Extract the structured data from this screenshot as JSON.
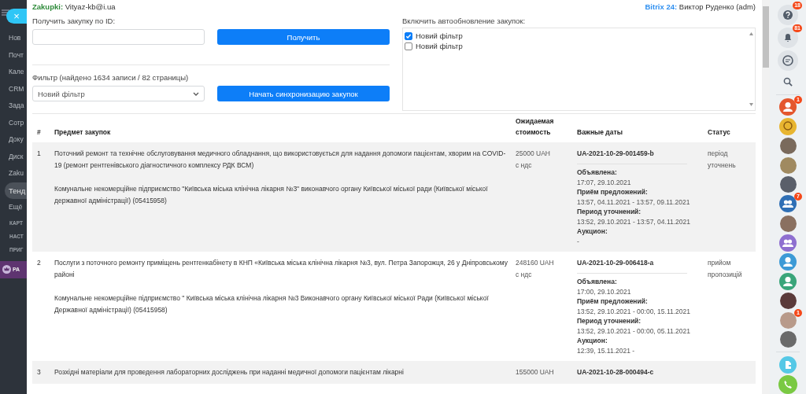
{
  "sidebar": {
    "close_button": "×",
    "items": [
      {
        "label": "Нов",
        "selected": false
      },
      {
        "label": "Почт",
        "selected": false
      },
      {
        "label": "Кале",
        "selected": false
      },
      {
        "label": "CRM",
        "selected": false
      },
      {
        "label": "Зада",
        "selected": false
      },
      {
        "label": "Сотр",
        "selected": false
      },
      {
        "label": "Доку",
        "selected": false
      },
      {
        "label": "Диск",
        "selected": false
      },
      {
        "label": "Zaku",
        "selected": false
      },
      {
        "label": "Тенд",
        "selected": true
      },
      {
        "label": "Ещё",
        "selected": false
      }
    ],
    "small_items": [
      "КАРТ",
      "НАСТ",
      "ПРИГ"
    ],
    "promo": "РА"
  },
  "header": {
    "app_label": "Zakupki:",
    "app_value": "Vityaz-kb@i.ua",
    "system_label": "Bitrix 24:",
    "system_value": "Виктор Руденко (adm)"
  },
  "id_form": {
    "label": "Получить закупку по ID:",
    "button": "Получить"
  },
  "filter": {
    "label": "Фильтр (найдено 1634 записи / 82 страницы)",
    "value": "Новий фільтр",
    "button": "Начать синхронизацию закупок"
  },
  "autoupdate": {
    "label": "Включить автообновление закупок:",
    "filters": [
      {
        "label": "Новий фільтр",
        "checked": true
      },
      {
        "label": "Новий фільтр",
        "checked": false
      }
    ]
  },
  "table": {
    "columns": [
      "#",
      "Предмет закупок",
      "Ожидаемая стоимость",
      "Важные даты",
      "Статус"
    ],
    "rows": [
      {
        "number": "1",
        "subject": "Поточний ремонт та технічне обслуговування медичного обладнання, що використовується для надання допомоги пацієнтам, хворим на COVID-19 (ремонт рентгенівського діагностичного комплексу РДК ВСМ)",
        "customer": "Комунальне некомерційне підприємство \"Київська міська клінічна лікарня №3\" виконавчого органу Київської міської ради (Київської міської державної адміністрації) (05415958)",
        "cost": "25000 UAH",
        "cost_note": "с ндс",
        "tender_id": "UA-2021-10-29-001459-b",
        "dates": [
          {
            "label": "Объявлена:",
            "value": "17:07, 29.10.2021"
          },
          {
            "label": "Приём предложений:",
            "value": "13:57, 04.11.2021 - 13:57, 09.11.2021"
          },
          {
            "label": "Период уточнений:",
            "value": "13:52, 29.10.2021 - 13:57, 04.11.2021"
          },
          {
            "label": "Аукцион:",
            "value": "-"
          }
        ],
        "status": "період уточнень"
      },
      {
        "number": "2",
        "subject": "Послуги з поточного ремонту приміщень рентгенкабінету в КНП «Київська міська клінічна лікарня №3, вул. Петра Запорожця, 26 у Дніпровському районі",
        "customer": "Комунальне некомерційне підприємство \" Київська міська клінічна лікарня №3 Виконавчого органу Київської міської Ради (Київської міської Державної адміністрації) (05415958)",
        "cost": "248160 UAH",
        "cost_note": "с ндс",
        "tender_id": "UA-2021-10-29-006418-a",
        "dates": [
          {
            "label": "Объявлена:",
            "value": "17:00, 29.10.2021"
          },
          {
            "label": "Приём предложений:",
            "value": "13:52, 29.10.2021 - 00:00, 15.11.2021"
          },
          {
            "label": "Период уточнений:",
            "value": "13:52, 29.10.2021 - 00:00, 05.11.2021"
          },
          {
            "label": "Аукцион:",
            "value": "12:39, 15.11.2021 -"
          }
        ],
        "status": "прийом пропозицій"
      },
      {
        "number": "3",
        "subject": "Розхідні матеріали для проведення лабораторних досліджень при наданні медичної допомоги пацієнтам лікарні",
        "cost": "155000 UAH",
        "tender_id": "UA-2021-10-28-000494-c"
      }
    ]
  },
  "right_bar": [
    {
      "kind": "help",
      "badge": "18"
    },
    {
      "kind": "bell",
      "badge": "81"
    },
    {
      "kind": "chat"
    },
    {
      "kind": "search"
    },
    {
      "kind": "divider"
    },
    {
      "kind": "person",
      "color": "#e4572e",
      "badge": "1"
    },
    {
      "kind": "logo",
      "color": "#e8b530"
    },
    {
      "kind": "photo",
      "color": "#7a6a5c"
    },
    {
      "kind": "photo",
      "color": "#a08a60"
    },
    {
      "kind": "photo",
      "color": "#5a5f6a"
    },
    {
      "kind": "group-chat",
      "color": "#2f6fb5",
      "badge": "7"
    },
    {
      "kind": "photo",
      "color": "#8a7060"
    },
    {
      "kind": "group",
      "color": "#8e6fd0"
    },
    {
      "kind": "person",
      "color": "#3c9ad6"
    },
    {
      "kind": "person",
      "color": "#3aa57a"
    },
    {
      "kind": "photo",
      "color": "#5a3a3a"
    },
    {
      "kind": "photo",
      "color": "#b89a8a",
      "badge": "1"
    },
    {
      "kind": "photo",
      "color": "#6a6a6a"
    },
    {
      "kind": "divider"
    },
    {
      "kind": "document",
      "color": "#55c8e6"
    },
    {
      "kind": "phone",
      "color": "#7ac943"
    }
  ]
}
